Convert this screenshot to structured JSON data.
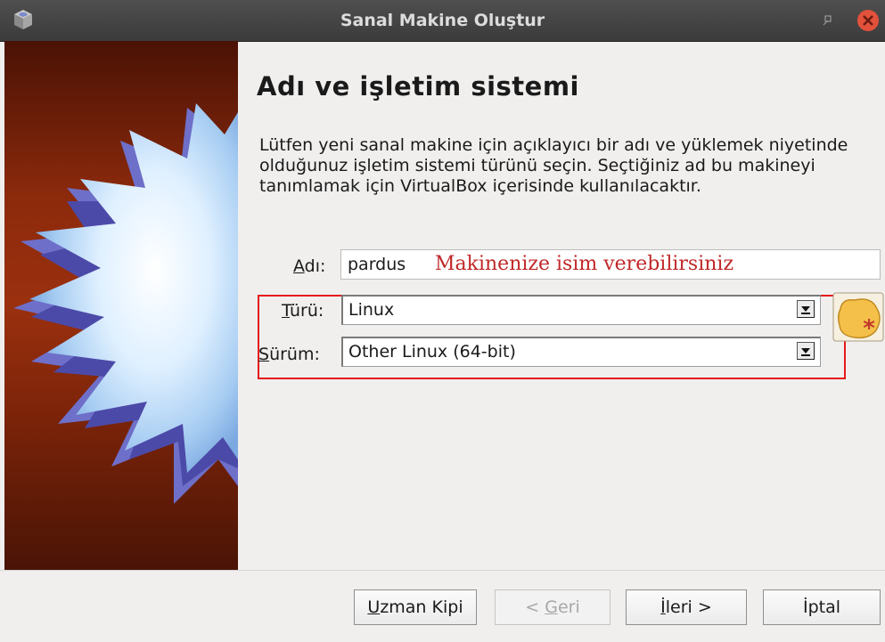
{
  "window": {
    "title": "Sanal Makine Oluştur",
    "icons": {
      "app": "virtualbox-cube-icon",
      "restore": "restore-icon",
      "close": "close-icon"
    },
    "colors": {
      "titlebar": "#454545",
      "close": "#e2513b",
      "banner": "#8d2a0c",
      "highlight_border": "#e51919",
      "hint_text": "#c02828"
    }
  },
  "page": {
    "heading": "Adı ve işletim sistemi",
    "description": "Lütfen yeni sanal makine için açıklayıcı bir adı ve yüklemek niyetinde olduğunuz işletim sistemi türünü seçin. Seçtiğiniz ad bu makineyi tanımlamak için VirtualBox içerisinde kullanılacaktır."
  },
  "form": {
    "name": {
      "label_mnemonic": "A",
      "label_rest": "dı:",
      "value": "pardus",
      "hint": "Makinenize isim verebilirsiniz"
    },
    "type": {
      "label_mnemonic": "T",
      "label_rest": "ürü:",
      "value": "Linux"
    },
    "version": {
      "label_mnemonic": "S",
      "label_rest": "ürüm:",
      "value": "Other Linux (64-bit)"
    },
    "os_icon": "linux-os-icon"
  },
  "buttons": {
    "expert": {
      "mnemonic": "U",
      "rest": "zman Kipi"
    },
    "back": {
      "prefix": "< ",
      "mnemonic": "G",
      "rest": "eri"
    },
    "next": {
      "mnemonic": "İ",
      "rest": "leri >"
    },
    "cancel": {
      "label": "İptal"
    }
  }
}
